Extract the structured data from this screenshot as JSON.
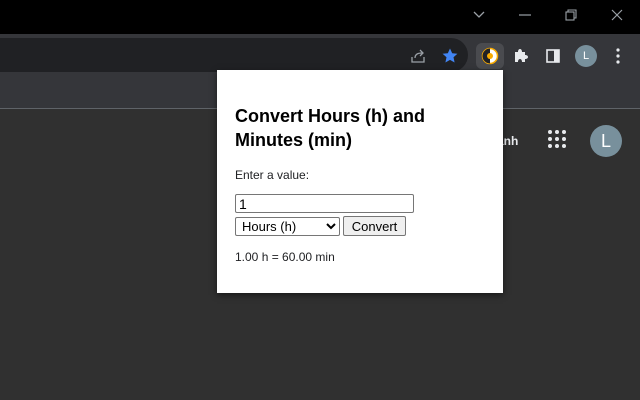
{
  "colors": {
    "titlebar": "#000000",
    "toolbar": "#35363a",
    "omnibox": "#202124",
    "page_background": "#303030",
    "popup_background": "#ffffff",
    "star_accent": "#4285f4",
    "avatar": "#78909c"
  },
  "window_controls": {
    "icons": [
      "chevron-down-icon",
      "minimize-icon",
      "restore-icon",
      "close-icon"
    ]
  },
  "toolbar": {
    "icons": [
      "share-icon",
      "bookmark-star-icon",
      "converter-extension-icon",
      "puzzle-extensions-icon",
      "side-panel-icon",
      "profile-avatar",
      "more-menu-icon"
    ],
    "profile_letter": "L"
  },
  "page": {
    "partial_text": "ành",
    "avatar_letter": "L"
  },
  "popup": {
    "title": "Convert Hours (h) and Minutes (min)",
    "prompt": "Enter a value:",
    "input_value": "1",
    "unit_selected": "Hours (h)",
    "unit_options": [
      "Hours (h)"
    ],
    "convert_label": "Convert",
    "result": "1.00 h = 60.00 min"
  }
}
